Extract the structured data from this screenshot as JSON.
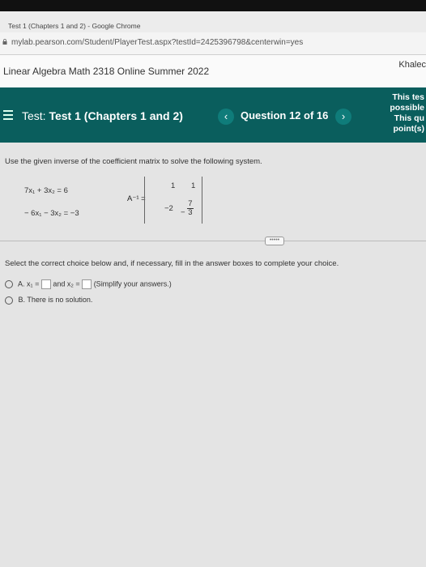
{
  "browser": {
    "title": "Test 1 (Chapters 1 and 2) - Google Chrome",
    "url": "mylab.pearson.com/Student/PlayerTest.aspx?testId=2425396798&centerwin=yes"
  },
  "course": {
    "title": "Linear Algebra Math 2318 Online Summer 2022",
    "user": "Khalec"
  },
  "test": {
    "label_prefix": "Test:",
    "name": "Test 1 (Chapters 1 and 2)",
    "question": "Question 12 of 16",
    "prev": "‹",
    "next": "›",
    "notice": [
      "This tes",
      "possible",
      "This qu",
      "point(s)"
    ]
  },
  "problem": {
    "prompt": "Use the given inverse of the coefficient matrix to solve the following system.",
    "eq1": "7x₁ + 3x₂ = 6",
    "eq2": "− 6x₁ − 3x₂ = −3",
    "ainv_label": "A⁻¹ =",
    "matrix": {
      "a11": "1",
      "a12": "1",
      "a21": "−2",
      "a22_sign": "−",
      "a22_num": "7",
      "a22_den": "3"
    },
    "expand": "•••••",
    "instruction": "Select the correct choice below and, if necessary, fill in the answer boxes to complete your choice.",
    "choiceA_label": "A.",
    "choiceA_x1": "x₁ =",
    "choiceA_and": "and x₂ =",
    "choiceA_hint": "(Simplify your answers.)",
    "choiceB_label": "B.",
    "choiceB_text": "There is no solution."
  }
}
